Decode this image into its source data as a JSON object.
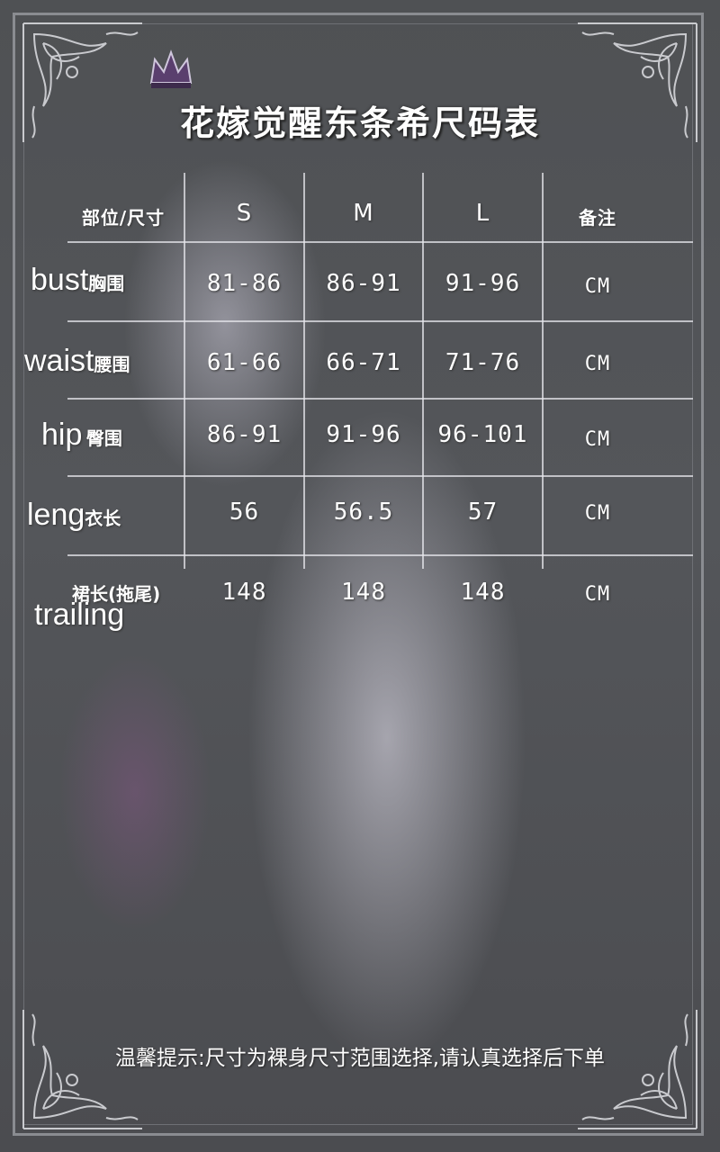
{
  "title": "花嫁觉醒东条希尺码表",
  "table": {
    "corner_header": "部位/尺寸",
    "size_headers": [
      "S",
      "M",
      "L"
    ],
    "notes_header": "备注",
    "rows": [
      {
        "en": "bust",
        "zh": "胸围",
        "values": [
          "81-86",
          "86-91",
          "91-96"
        ],
        "unit": "CM"
      },
      {
        "en": "waist",
        "zh": "腰围",
        "values": [
          "61-66",
          "66-71",
          "71-76"
        ],
        "unit": "CM"
      },
      {
        "en": "hip",
        "zh": "臀围",
        "values": [
          "86-91",
          "91-96",
          "96-101"
        ],
        "unit": "CM"
      },
      {
        "en": "leng",
        "zh": "衣长",
        "values": [
          "56",
          "56.5",
          "57"
        ],
        "unit": "CM"
      },
      {
        "en": "trailing",
        "zh": "裙长(拖尾)",
        "values": [
          "148",
          "148",
          "148"
        ],
        "unit": "CM"
      }
    ]
  },
  "footer_note": "温馨提示:尺寸为裸身尺寸范围选择,请认真选择后下单",
  "colors": {
    "background": "#4b4d50",
    "frame": "#8a8c91",
    "text": "#ffffff"
  },
  "icons": [
    "ornament-corner-icon",
    "crown-icon"
  ]
}
